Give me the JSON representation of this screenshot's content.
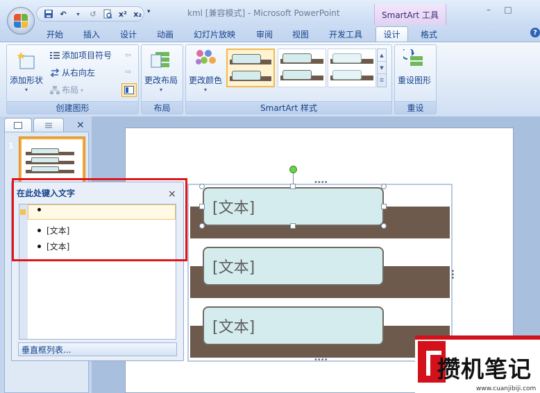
{
  "window": {
    "title": "kml [兼容模式] - Microsoft PowerPoint",
    "context_tools": "SmartArt 工具",
    "minimize": "–",
    "maximize": "□"
  },
  "qat": {
    "save": "save-icon",
    "undo": "↶",
    "redo": "↺",
    "superscript": "x²",
    "subscript": "x₂",
    "more": "▾"
  },
  "tabs": [
    "开始",
    "插入",
    "设计",
    "动画",
    "幻灯片放映",
    "审阅",
    "视图",
    "开发工具",
    "设计",
    "格式"
  ],
  "active_tab_index": 8,
  "help": "?",
  "ribbon": {
    "create_graphic": {
      "label": "创建图形",
      "add_shape": "添加形状",
      "add_bullet": "添加项目符号",
      "right_to_left": "从右向左",
      "layout": "布局"
    },
    "layouts": {
      "label": "布局",
      "change_layout": "更改布局"
    },
    "styles": {
      "label": "SmartArt 样式",
      "change_colors": "更改颜色"
    },
    "reset": {
      "label": "重设",
      "reset_graphic": "重设图形"
    }
  },
  "slide_panel": {
    "slide_number": "1"
  },
  "text_pane": {
    "title": "在此处键入文字",
    "close": "×",
    "items": [
      "",
      "[文本]",
      "[文本]"
    ],
    "footer": "垂直框列表..."
  },
  "smartart": {
    "boxes": [
      "[文本]",
      "[文本]",
      "[文本]"
    ],
    "colors": {
      "band": "#6d5a4c",
      "box_fill": "#d5ecef",
      "box_border": "#6f6a60",
      "text": "#5d5d5d"
    }
  },
  "watermark": {
    "text": "攒机笔记",
    "url": "www.cuanjibiji.com"
  },
  "colors": {
    "selection_outline": "#e1141c",
    "ribbon_text": "#15428b",
    "gallery_selected": "#f3b94a"
  }
}
